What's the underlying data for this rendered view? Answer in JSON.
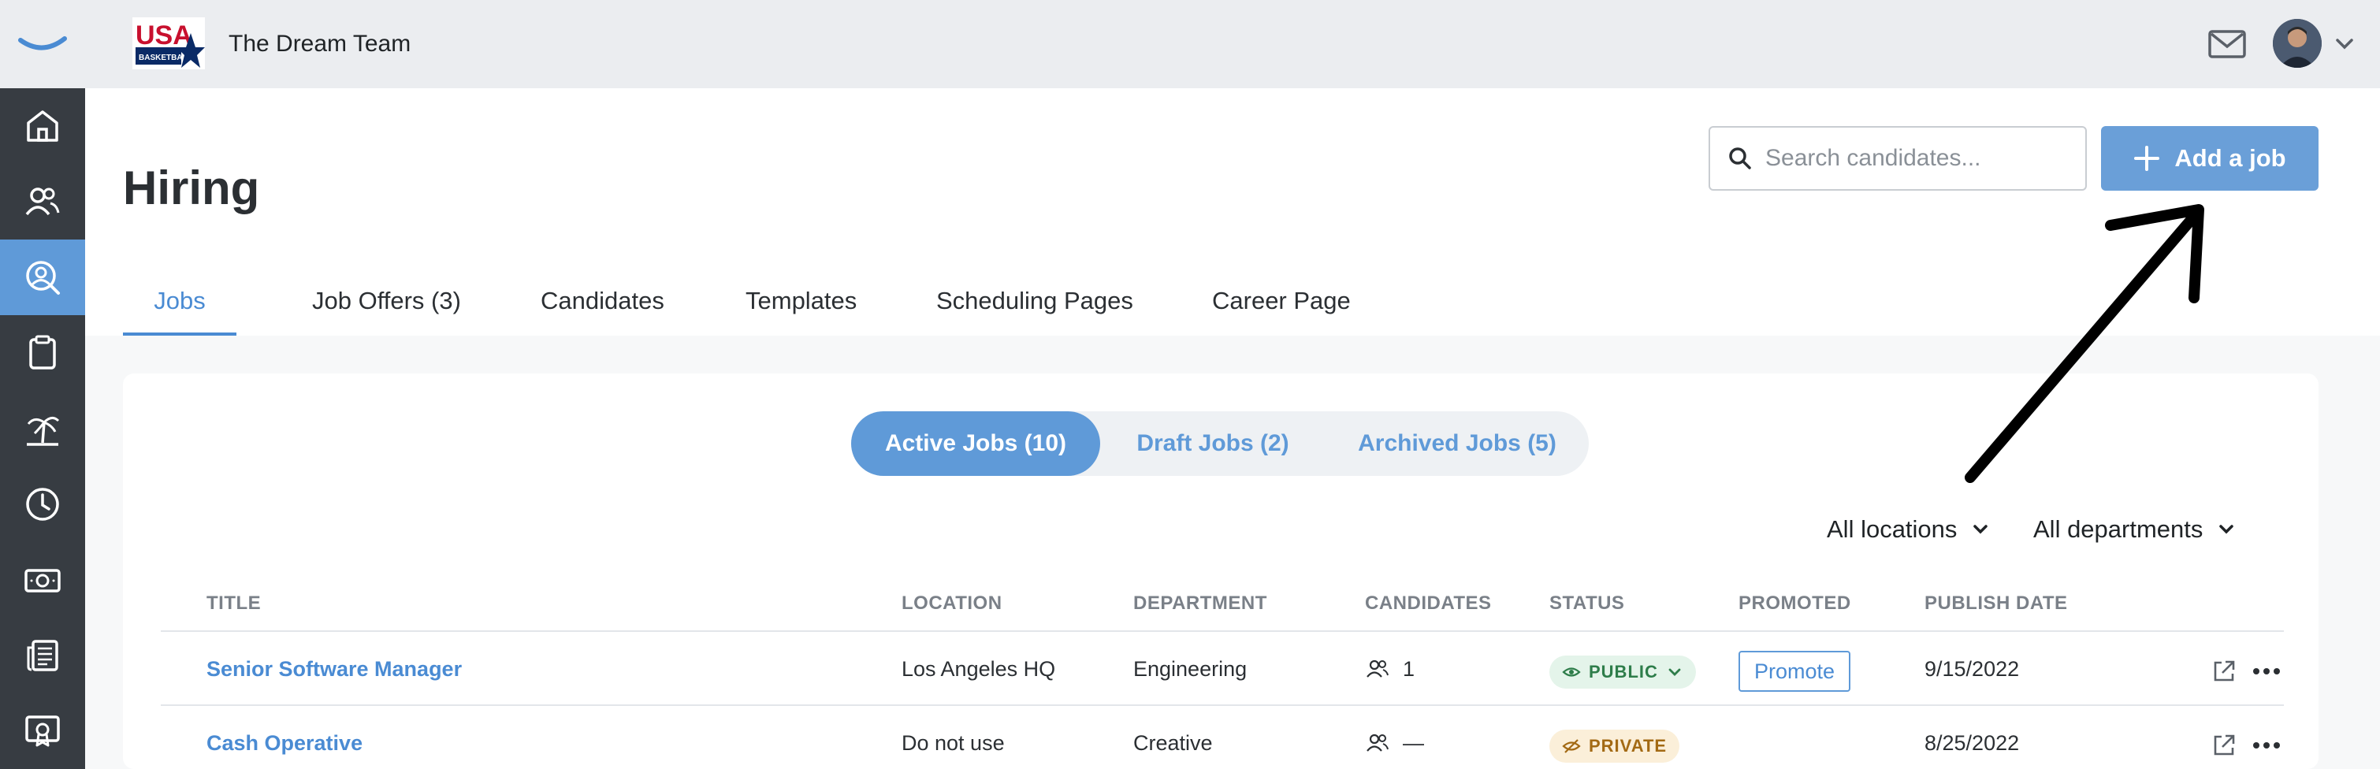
{
  "topbar": {
    "team_name": "The Dream Team",
    "logo_text": "USA",
    "logo_subtext": "BASKETBALL"
  },
  "sidebar": {
    "items": [
      {
        "icon": "home-icon"
      },
      {
        "icon": "people-icon"
      },
      {
        "icon": "hiring-search-icon",
        "active": true
      },
      {
        "icon": "clipboard-icon"
      },
      {
        "icon": "time-off-island-icon"
      },
      {
        "icon": "clock-icon"
      },
      {
        "icon": "payroll-money-icon"
      },
      {
        "icon": "news-icon"
      },
      {
        "icon": "certificate-icon"
      }
    ]
  },
  "page": {
    "title": "Hiring"
  },
  "search": {
    "placeholder": "Search candidates..."
  },
  "add_job": {
    "label": "Add a job"
  },
  "tabs": [
    {
      "label": "Jobs",
      "active": true
    },
    {
      "label": "Job Offers (3)"
    },
    {
      "label": "Candidates"
    },
    {
      "label": "Templates"
    },
    {
      "label": "Scheduling Pages"
    },
    {
      "label": "Career Page"
    }
  ],
  "job_filters": [
    {
      "label": "Active Jobs (10)",
      "active": true
    },
    {
      "label": "Draft Jobs (2)"
    },
    {
      "label": "Archived Jobs (5)"
    }
  ],
  "dropdowns": {
    "location": "All locations",
    "department": "All departments"
  },
  "table": {
    "columns": [
      "TITLE",
      "LOCATION",
      "DEPARTMENT",
      "CANDIDATES",
      "STATUS",
      "PROMOTED",
      "PUBLISH DATE"
    ],
    "rows": [
      {
        "title": "Senior Software Manager",
        "location": "Los Angeles HQ",
        "department": "Engineering",
        "candidates": "1",
        "status": "PUBLIC",
        "promote_label": "Promote",
        "publish_date": "9/15/2022"
      },
      {
        "title": "Cash Operative",
        "location": "Do not use",
        "department": "Creative",
        "candidates": "—",
        "status": "PRIVATE",
        "promote_label": "",
        "publish_date": "8/25/2022"
      }
    ]
  },
  "colors": {
    "accent": "#5f9ad8",
    "sidebar_bg": "#373c42",
    "topbar_bg": "#ebedf0",
    "public_badge": "#2e7d4a",
    "private_badge": "#a36a14"
  }
}
